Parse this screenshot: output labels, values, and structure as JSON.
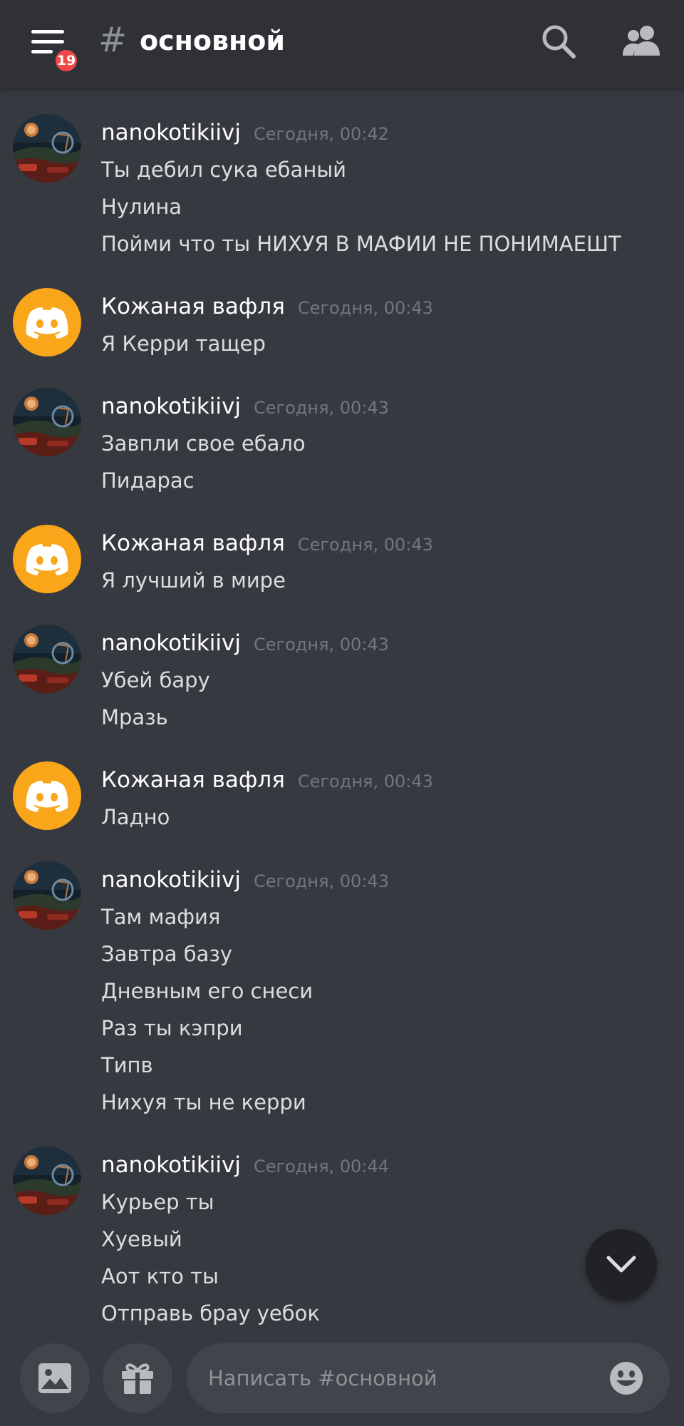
{
  "header": {
    "unread_badge": "19",
    "channel_hash": "#",
    "channel_name": "основной"
  },
  "messages": [
    {
      "author": "nanokotikiivj",
      "time": "Сегодня, 00:42",
      "avatar": "profile-picture",
      "lines": [
        "Ты дебил сука ебаный",
        "Нулина",
        "Пойми что ты НИХУЯ В МАФИИ НЕ ПОНИМАЕШТ"
      ]
    },
    {
      "author": "Кожаная вафля",
      "time": "Сегодня, 00:43",
      "avatar": "discord-default",
      "lines": [
        "Я Керри тащер"
      ]
    },
    {
      "author": "nanokotikiivj",
      "time": "Сегодня, 00:43",
      "avatar": "profile-picture",
      "lines": [
        "Завпли свое ебало",
        "Пидарас"
      ]
    },
    {
      "author": "Кожаная вафля",
      "time": "Сегодня, 00:43",
      "avatar": "discord-default",
      "lines": [
        "Я лучший в мире"
      ]
    },
    {
      "author": "nanokotikiivj",
      "time": "Сегодня, 00:43",
      "avatar": "profile-picture",
      "lines": [
        "Убей бару",
        "Мразь"
      ]
    },
    {
      "author": "Кожаная вафля",
      "time": "Сегодня, 00:43",
      "avatar": "discord-default",
      "lines": [
        "Ладно"
      ]
    },
    {
      "author": "nanokotikiivj",
      "time": "Сегодня, 00:43",
      "avatar": "profile-picture",
      "lines": [
        "Там мафия",
        "Завтра базу",
        "Дневным его снеси",
        "Раз ты кэпри",
        "Типв",
        "Нихуя ты не керри"
      ]
    },
    {
      "author": "nanokotikiivj",
      "time": "Сегодня, 00:44",
      "avatar": "profile-picture",
      "lines": [
        "Курьер ты",
        "Хуевый",
        "Аот кто ты",
        "Отправь брау уебок"
      ]
    },
    {
      "author": "Кожаная вафля",
      "time": "",
      "avatar": "discord-default",
      "lines": []
    }
  ],
  "composer": {
    "placeholder": "Написать #основной"
  },
  "colors": {
    "background": "#36393f",
    "header": "#2f3136",
    "badge": "#f04747",
    "discord_avatar": "#faa61a",
    "input": "#40444b",
    "timestamp": "#72767d"
  },
  "icons": {
    "menu": "hamburger-icon",
    "search": "search-icon",
    "members": "members-icon",
    "scroll": "chevron-down-icon",
    "image": "image-icon",
    "gift": "gift-icon",
    "emoji": "emoji-icon"
  }
}
